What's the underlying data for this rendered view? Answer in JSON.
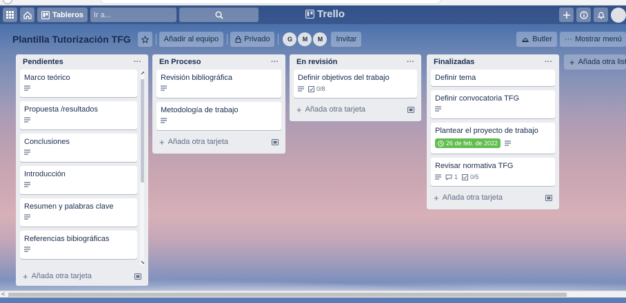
{
  "header": {
    "boards_label": "Tableros",
    "search_placeholder": "Ir a...",
    "logo_text": "Trello"
  },
  "boardbar": {
    "title": "Plantilla Tutorización TFG",
    "add_team_label": "Añadir al equipo",
    "privacy_label": "Privado",
    "invite_label": "Invitar",
    "members": [
      "G",
      "M",
      "M"
    ],
    "butler_label": "Butler",
    "show_menu_label": "Mostrar menú"
  },
  "lists": [
    {
      "title": "Pendientes",
      "cards": [
        {
          "title": "Marco teórico"
        },
        {
          "title": "Propuesta /resultados"
        },
        {
          "title": "Conclusiones"
        },
        {
          "title": "Introducción"
        },
        {
          "title": "Resumen y palabras clave"
        },
        {
          "title": "Referencias bibiográficas"
        }
      ],
      "add_card_label": "Añada otra tarjeta"
    },
    {
      "title": "En Proceso",
      "cards": [
        {
          "title": "Revisión bibliográfica"
        },
        {
          "title": "Metodología de trabajo"
        }
      ],
      "add_card_label": "Añada otra tarjeta"
    },
    {
      "title": "En revisión",
      "cards": [
        {
          "title": "Definir objetivos del trabajo",
          "checklist": "0/8"
        }
      ],
      "add_card_label": "Añada otra tarjeta"
    },
    {
      "title": "Finalizadas",
      "cards": [
        {
          "title": "Definir tema"
        },
        {
          "title": "Definir convocatoria TFG"
        },
        {
          "title": "Plantear el proyecto de trabajo",
          "due": "26 de feb. de 2022"
        },
        {
          "title": "Revisar normativa TFG",
          "comments": "1",
          "checklist": "0/5"
        }
      ],
      "add_card_label": "Añada otra tarjeta"
    }
  ],
  "add_list_label": "Añada otra lista",
  "colors": {
    "list_bg": "#ebecf0",
    "due_badge": "#61bd4f",
    "header_bg": "#2c4678"
  }
}
